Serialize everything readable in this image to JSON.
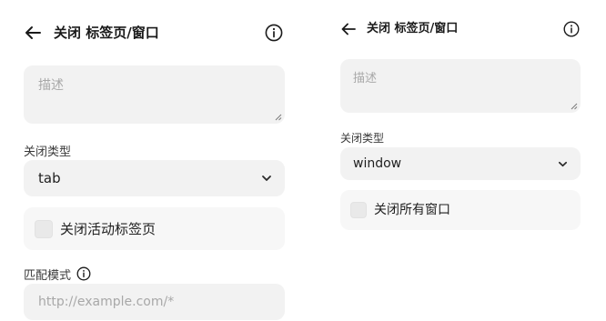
{
  "left": {
    "title": "关闭 标签页/窗口",
    "description_placeholder": "描述",
    "close_type_label": "关闭类型",
    "close_type_value": "tab",
    "checkbox_label": "关闭活动标签页",
    "checkbox_checked": false,
    "match_pattern_label": "匹配模式",
    "match_pattern_placeholder": "http://example.com/*"
  },
  "right": {
    "title": "关闭 标签页/窗口",
    "description_placeholder": "描述",
    "close_type_label": "关闭类型",
    "close_type_value": "window",
    "checkbox_label": "关闭所有窗口",
    "checkbox_checked": false
  },
  "colors": {
    "field_bg": "#f2f2f2",
    "row_bg": "#f7f7f7",
    "placeholder": "#a8a8a8",
    "text": "#1f1f1f"
  },
  "icons": {
    "back": "arrow-left",
    "info": "info-circle",
    "chevron": "chevron-down"
  }
}
